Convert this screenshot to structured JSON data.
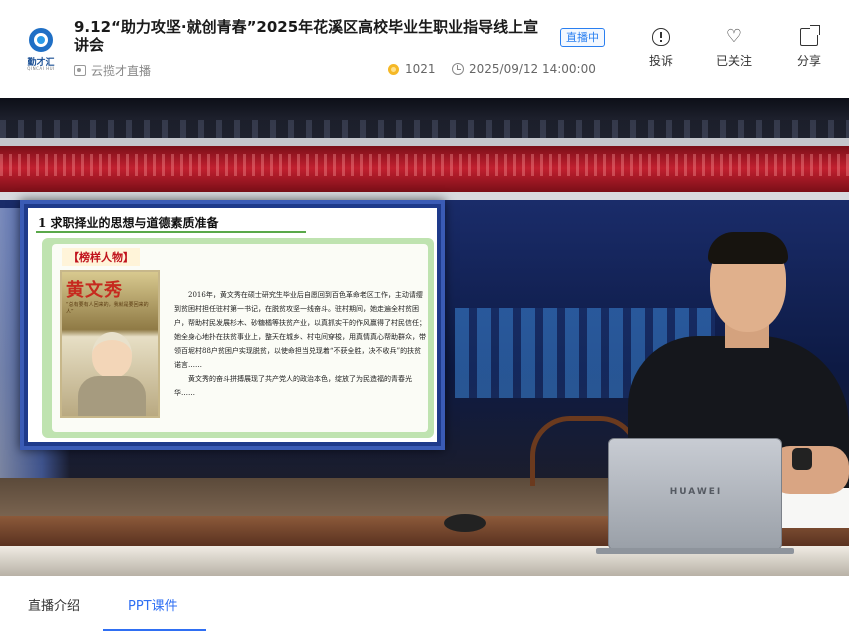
{
  "header": {
    "logo": {
      "brand": "勤才汇",
      "sub": "QINCAI HUI"
    },
    "title": "9.12“助力攻坚·就创青春”2025年花溪区高校毕业生职业指导线上宣讲会",
    "status_badge": "直播中",
    "channel": "云揽才直播",
    "views": "1021",
    "datetime": "2025/09/12 14:00:00",
    "actions": {
      "report": "投诉",
      "follow": "已关注",
      "share": "分享"
    }
  },
  "slide": {
    "title": "1  求职择业的思想与道德素质准备",
    "tag": "【榜样人物】",
    "poster_name": "黄文秀",
    "poster_quote": "“总有要有人回来的，我就是要回来的人”",
    "paragraph1": "2016年，黄文秀在硕士研究生毕业后自愿回到百色革命老区工作，主动请缨到贫困村担任驻村第一书记，在脱贫攻坚一线奋斗。驻村期间，她走遍全村贫困户，帮助村民发展杉木、砂糖橘等扶贫产业，以真抓实干的作风赢得了村民信任；她全身心地扑在扶贫事业上，整天在城乡、村屯间穿梭，用真情真心帮助群众，带领百坭村88户贫困户实现脱贫，以使命担当兑现着“不获全胜，决不收兵”的扶贫诺言……",
    "paragraph2": "黄文秀的奋斗拼搏展现了共产党人的政治本色，绽放了为民造福的青春光华……"
  },
  "video": {
    "laptop_brand": "HUAWEI"
  },
  "tabs": [
    {
      "label": "直播介绍",
      "active": false
    },
    {
      "label": "PPT课件",
      "active": true
    }
  ],
  "colors": {
    "accent": "#2f6ff3",
    "badge": "#2a7ff0",
    "coin": "#f5b826",
    "slide_red": "#c0121b"
  }
}
